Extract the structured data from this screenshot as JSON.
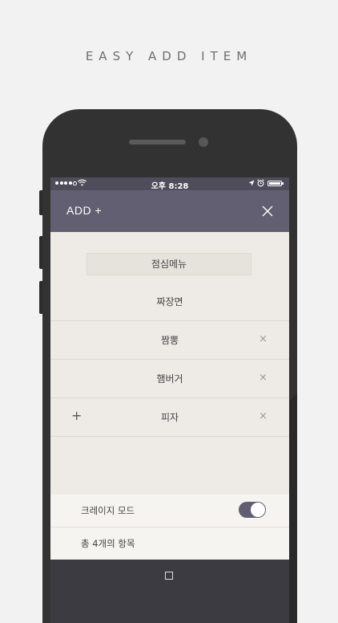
{
  "headline": "EASY ADD ITEM",
  "status_bar": {
    "time": "오후 8:28"
  },
  "nav": {
    "title": "ADD +",
    "close_icon": "close-icon"
  },
  "list": {
    "title": "점심메뉴",
    "items": [
      {
        "label": "짜장면",
        "removable": false
      },
      {
        "label": "짬뽕",
        "removable": true
      },
      {
        "label": "햄버거",
        "removable": true
      },
      {
        "label": "피자",
        "removable": true,
        "add_button": "+"
      }
    ],
    "remove_glyph": "×"
  },
  "footer": {
    "crazy_mode_label": "크레이지 모드",
    "crazy_mode_on": true,
    "total_label": "총 4개의 항목"
  },
  "colors": {
    "accent": "#635f72",
    "background": "#eeebe7",
    "status_bar": "#4f4d5c"
  }
}
